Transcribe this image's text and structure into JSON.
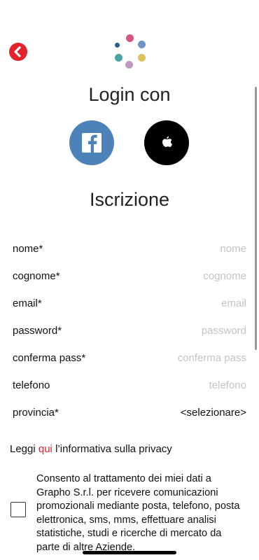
{
  "header": {
    "back_icon": "chevron-left-icon",
    "logo_icon": "dots-logo"
  },
  "login": {
    "title": "Login con",
    "facebook_icon": "facebook-icon",
    "apple_icon": "apple-icon"
  },
  "registration": {
    "title": "Iscrizione",
    "fields": [
      {
        "label": "nome*",
        "placeholder": "nome"
      },
      {
        "label": "cognome*",
        "placeholder": "cognome"
      },
      {
        "label": "email*",
        "placeholder": "email"
      },
      {
        "label": "password*",
        "placeholder": "password"
      },
      {
        "label": "conferma pass*",
        "placeholder": "conferma pass"
      },
      {
        "label": "telefono",
        "placeholder": "telefono"
      }
    ],
    "province": {
      "label": "provincia*",
      "value": "<selezionare>"
    }
  },
  "privacy": {
    "prefix": "Leggi ",
    "link": "qui",
    "suffix": " l’informativa sulla privacy"
  },
  "consent": {
    "text": "Consento al trattamento dei miei dati a Grapho S.r.l. per ricevere comunicazioni promozionali mediante posta, telefono, posta elettronica, sms, mms, effettuare analisi statistiche, studi e ricerche di mercato da parte di altre Aziende.",
    "checked": false
  },
  "colors": {
    "accent": "#e3222a",
    "facebook": "#4d82b8",
    "apple": "#000000"
  }
}
